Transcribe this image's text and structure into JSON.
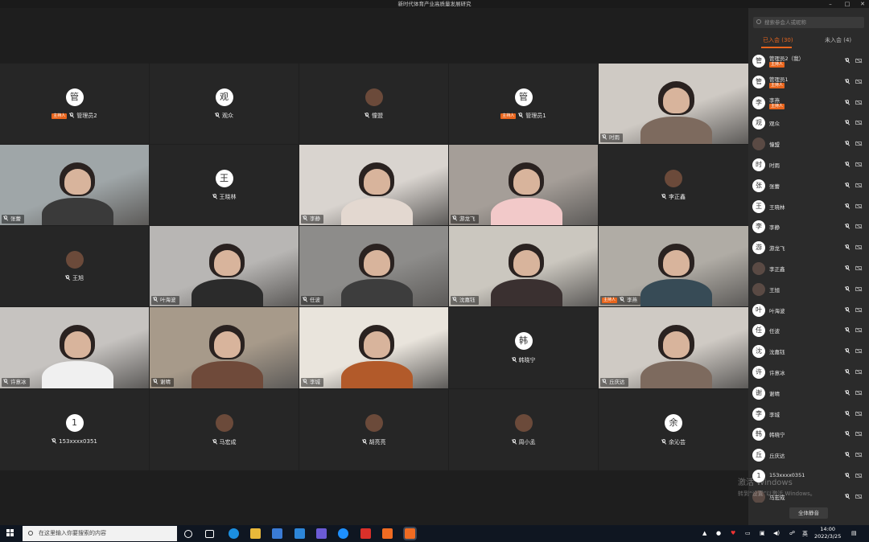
{
  "window": {
    "title": "新时代体育产业高质量发展研究",
    "minimize": "–",
    "maximize": "□",
    "close": "✕"
  },
  "tiles": [
    {
      "name": "管理员2",
      "avatar": "管",
      "host": true,
      "video": false
    },
    {
      "name": "观众",
      "avatar": "观",
      "host": false,
      "video": false
    },
    {
      "name": "憧盟",
      "avatar": "",
      "host": false,
      "video": false,
      "photo": true
    },
    {
      "name": "管理员1",
      "avatar": "管",
      "host": true,
      "video": false
    },
    {
      "name": "时雨",
      "host": false,
      "video": true
    },
    {
      "name": "张蕾",
      "host": false,
      "video": true
    },
    {
      "name": "王晓林",
      "avatar": "王",
      "host": false,
      "video": false
    },
    {
      "name": "李静",
      "host": false,
      "video": true
    },
    {
      "name": "游龙飞",
      "host": false,
      "video": true
    },
    {
      "name": "李正鑫",
      "avatar": "",
      "host": false,
      "video": false,
      "photo": true
    },
    {
      "name": "王旭",
      "avatar": "",
      "host": false,
      "video": false,
      "photo": true
    },
    {
      "name": "叶海波",
      "host": false,
      "video": true
    },
    {
      "name": "任波",
      "host": false,
      "video": true
    },
    {
      "name": "沈嘉钰",
      "host": false,
      "video": true
    },
    {
      "name": "李燕",
      "host": true,
      "video": true,
      "active": true
    },
    {
      "name": "许意冰",
      "host": false,
      "video": true
    },
    {
      "name": "谢晴",
      "host": false,
      "video": true
    },
    {
      "name": "李城",
      "host": false,
      "video": true
    },
    {
      "name": "韩晓宁",
      "avatar": "韩",
      "host": false,
      "video": false
    },
    {
      "name": "丘庆达",
      "host": false,
      "video": true
    },
    {
      "name": "153xxxx0351",
      "avatar": "1",
      "host": false,
      "video": false
    },
    {
      "name": "马宏成",
      "avatar": "",
      "host": false,
      "video": false,
      "photo": true
    },
    {
      "name": "胡亮亮",
      "avatar": "",
      "host": false,
      "video": false,
      "photo": true
    },
    {
      "name": "周小孟",
      "avatar": "",
      "host": false,
      "video": false,
      "photo": true
    },
    {
      "name": "余沁芸",
      "avatar": "余",
      "host": false,
      "video": false
    }
  ],
  "panel": {
    "search_placeholder": "搜索参会人或昵称",
    "tab_in": "已入会 (30)",
    "tab_out": "未入会 (4)",
    "host_badge": "主持人",
    "mute_all": "全体静音",
    "participants": [
      {
        "name": "管理员2（我）",
        "avatar": "管",
        "host": true
      },
      {
        "name": "管理员1",
        "avatar": "管",
        "host": true
      },
      {
        "name": "李燕",
        "avatar": "李",
        "host": true
      },
      {
        "name": "观众",
        "avatar": "观",
        "host": false
      },
      {
        "name": "憧盟",
        "avatar": "",
        "host": false,
        "photo": true
      },
      {
        "name": "时雨",
        "avatar": "时",
        "host": false
      },
      {
        "name": "张蕾",
        "avatar": "张",
        "host": false
      },
      {
        "name": "王晓林",
        "avatar": "王",
        "host": false
      },
      {
        "name": "李静",
        "avatar": "李",
        "host": false
      },
      {
        "name": "游龙飞",
        "avatar": "游",
        "host": false
      },
      {
        "name": "李正鑫",
        "avatar": "",
        "host": false,
        "photo": true
      },
      {
        "name": "王旭",
        "avatar": "",
        "host": false,
        "photo": true
      },
      {
        "name": "叶海波",
        "avatar": "叶",
        "host": false
      },
      {
        "name": "任波",
        "avatar": "任",
        "host": false
      },
      {
        "name": "沈嘉钰",
        "avatar": "沈",
        "host": false
      },
      {
        "name": "许意冰",
        "avatar": "许",
        "host": false
      },
      {
        "name": "谢晴",
        "avatar": "谢",
        "host": false
      },
      {
        "name": "李城",
        "avatar": "李",
        "host": false
      },
      {
        "name": "韩晓宁",
        "avatar": "韩",
        "host": false
      },
      {
        "name": "丘庆达",
        "avatar": "丘",
        "host": false
      },
      {
        "name": "153xxxx0351",
        "avatar": "1",
        "host": false
      },
      {
        "name": "马宏成",
        "avatar": "",
        "host": false,
        "photo": true
      }
    ]
  },
  "watermark": {
    "line1": "激活 Windows",
    "line2": "转到“设置”以激活 Windows。"
  },
  "taskbar": {
    "search_placeholder": "在这里输入你要搜索的内容",
    "time": "14:00",
    "date": "2022/3/25",
    "ime": "英"
  }
}
